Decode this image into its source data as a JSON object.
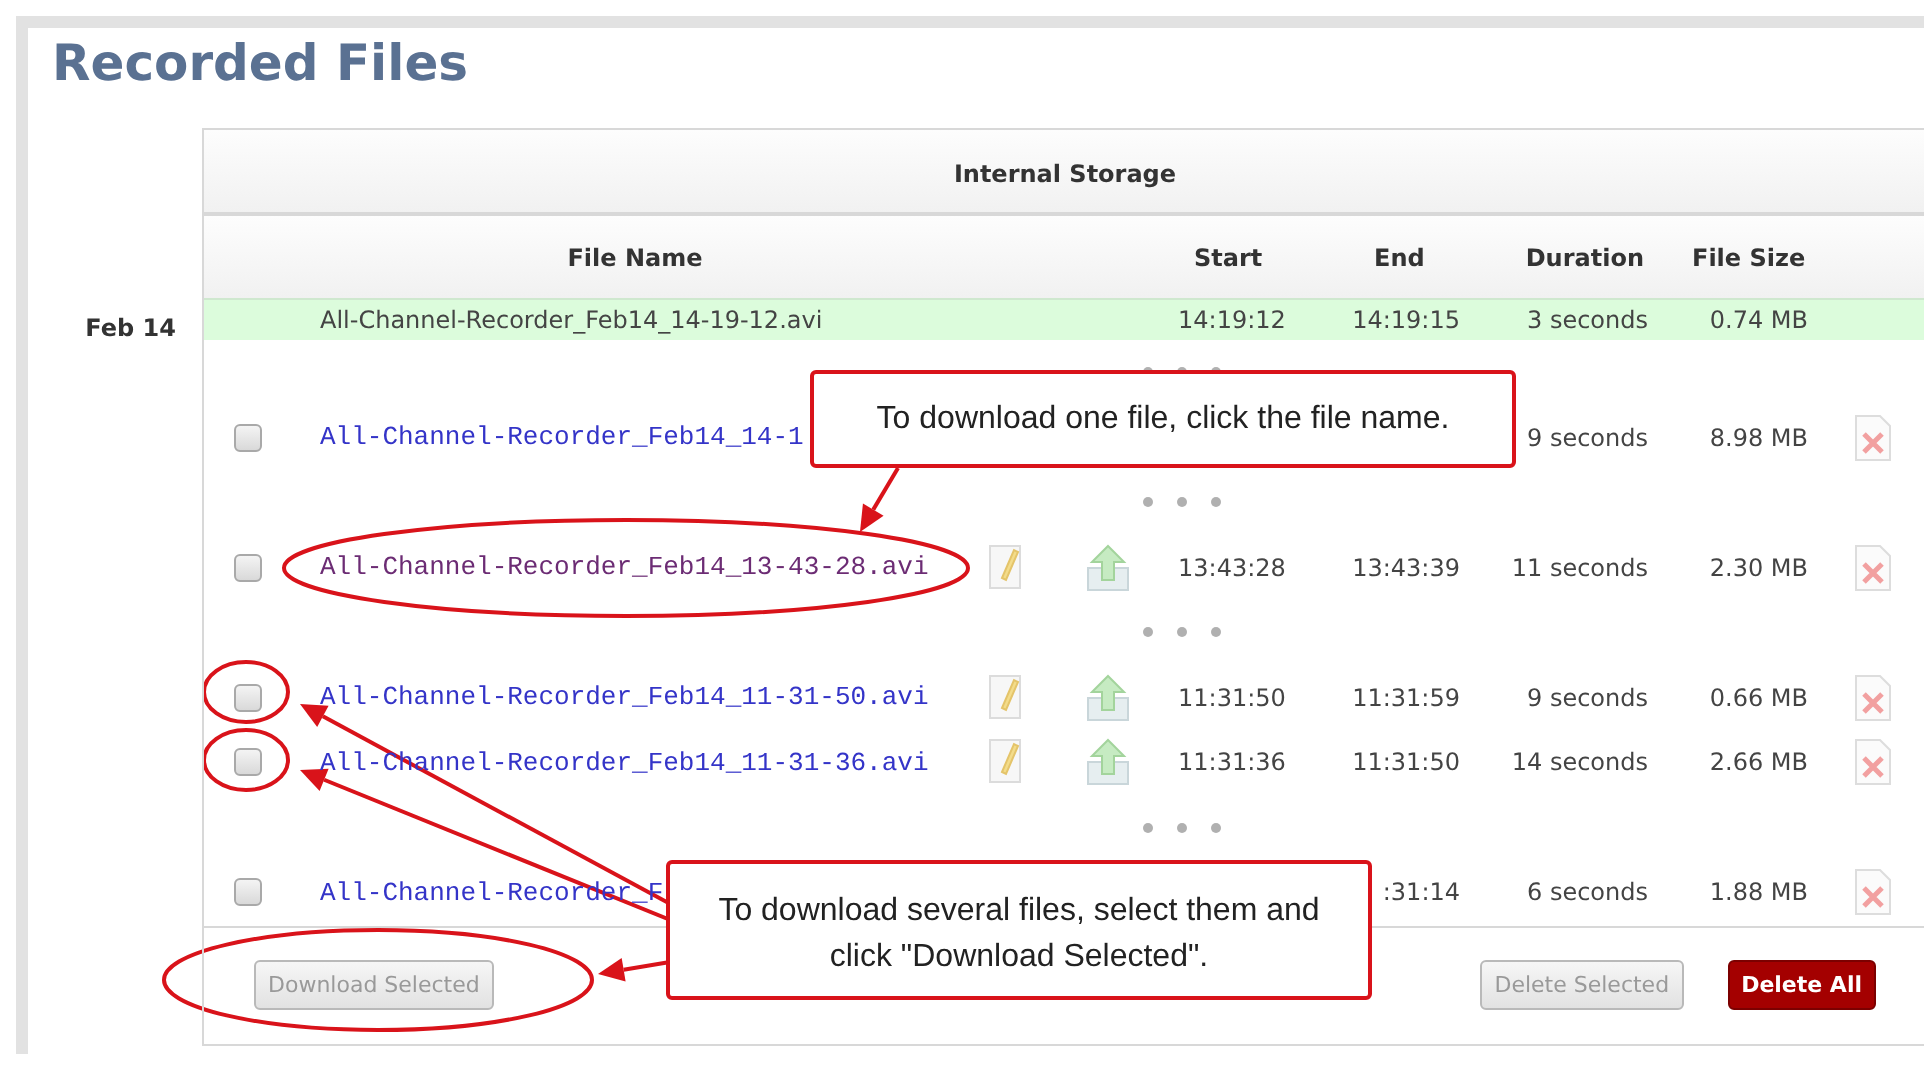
{
  "page": {
    "title": "Recorded Files"
  },
  "storage": {
    "title": "Internal Storage",
    "date": "Feb 14",
    "columns": {
      "name": "File Name",
      "start": "Start",
      "end": "End",
      "duration": "Duration",
      "size": "File Size"
    },
    "rows": [
      {
        "kind": "file",
        "recording": true,
        "name": "All-Channel-Recorder_Feb14_14-19-12.avi",
        "start": "14:19:12",
        "end": "14:19:15",
        "duration": "3 seconds",
        "size": "0.74 MB"
      },
      {
        "kind": "gap"
      },
      {
        "kind": "file",
        "checked": false,
        "name": "All-Channel-Recorder_Feb14_14-1",
        "duration": "9 seconds",
        "size": "8.98 MB",
        "delete_icon": true
      },
      {
        "kind": "gap"
      },
      {
        "kind": "file",
        "checked": false,
        "visited": true,
        "name": "All-Channel-Recorder_Feb14_13-43-28.avi",
        "edit_icon": true,
        "upload_icon": true,
        "start": "13:43:28",
        "end": "13:43:39",
        "duration": "11 seconds",
        "size": "2.30 MB",
        "delete_icon": true
      },
      {
        "kind": "gap"
      },
      {
        "kind": "file",
        "checked": false,
        "name": "All-Channel-Recorder_Feb14_11-31-50.avi",
        "edit_icon": true,
        "upload_icon": true,
        "start": "11:31:50",
        "end": "11:31:59",
        "duration": "9 seconds",
        "size": "0.66 MB",
        "delete_icon": true
      },
      {
        "kind": "file",
        "checked": false,
        "name": "All-Channel-Recorder_Feb14_11-31-36.avi",
        "edit_icon": true,
        "upload_icon": true,
        "start": "11:31:36",
        "end": "11:31:50",
        "duration": "14 seconds",
        "size": "2.66 MB",
        "delete_icon": true
      },
      {
        "kind": "gap"
      },
      {
        "kind": "file",
        "checked": false,
        "name": "All-Channel-Recorder_F",
        "end": ":31:14",
        "duration": "6 seconds",
        "size": "1.88 MB",
        "delete_icon": true
      }
    ],
    "buttons": [
      {
        "label": "Download Selected",
        "kind": "normal",
        "disabled": true
      },
      {
        "label": "Delete Selected",
        "kind": "normal",
        "disabled": true
      },
      {
        "label": "Delete All",
        "kind": "danger",
        "disabled": false
      }
    ]
  },
  "annotations": {
    "callouts": [
      {
        "text": "To download one file, click the file name."
      },
      {
        "text": "To download several files, select them and click \"Download Selected\"."
      }
    ]
  }
}
